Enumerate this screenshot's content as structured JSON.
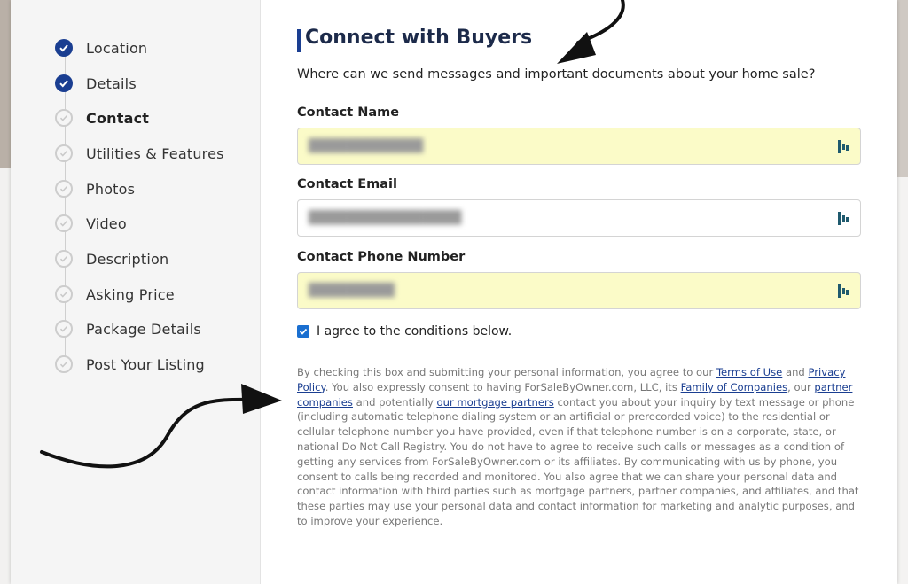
{
  "steps": [
    {
      "label": "Location",
      "state": "done"
    },
    {
      "label": "Details",
      "state": "done"
    },
    {
      "label": "Contact",
      "state": "active"
    },
    {
      "label": "Utilities & Features",
      "state": "todo"
    },
    {
      "label": "Photos",
      "state": "todo"
    },
    {
      "label": "Video",
      "state": "todo"
    },
    {
      "label": "Description",
      "state": "todo"
    },
    {
      "label": "Asking Price",
      "state": "todo"
    },
    {
      "label": "Package Details",
      "state": "todo"
    },
    {
      "label": "Post Your Listing",
      "state": "todo"
    }
  ],
  "form": {
    "title": "Connect with Buyers",
    "subtitle": "Where can we send messages and important documents about your home sale?",
    "name_label": "Contact Name",
    "email_label": "Contact Email",
    "phone_label": "Contact Phone Number",
    "field_icon": "password-manager-icon",
    "agree_label": "I agree to the conditions below.",
    "agree_checked": true
  },
  "legal": {
    "t1": "By checking this box and submitting your personal information, you agree to our ",
    "terms": "Terms of Use",
    "t2": " and ",
    "privacy": "Privacy Policy",
    "t3": ". You also expressly consent to having ForSaleByOwner.com, LLC, its ",
    "family": "Family of Companies",
    "t4": ", our ",
    "partners": "partner companies",
    "t5": " and potentially ",
    "mortgage": "our mortgage partners",
    "t6": " contact you about your inquiry by text message or phone (including automatic telephone dialing system or an artificial or prerecorded voice) to the residential or cellular telephone number you have provided, even if that telephone number is on a corporate, state, or national Do Not Call Registry. You do not have to agree to receive such calls or messages as a condition of getting any services from ForSaleByOwner.com or its affiliates. By communicating with us by phone, you consent to calls being recorded and monitored. You also agree that we can share your personal data and contact information with third parties such as mortgage partners, partner companies, and affiliates, and that these parties may use your personal data and contact information for marketing and analytic purposes, and to improve your experience."
  },
  "colors": {
    "accent": "#1a3e91",
    "autofill": "#fbfbc8",
    "checkbox": "#1a6fd0"
  }
}
